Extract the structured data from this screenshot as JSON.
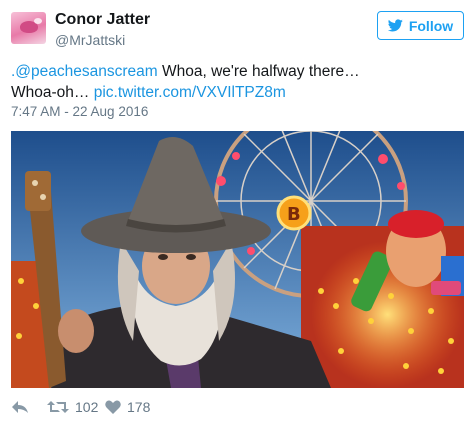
{
  "user": {
    "display_name": "Conor Jatter",
    "handle": "@MrJattski",
    "avatar_icon": "pink-blob-avatar"
  },
  "follow_button": {
    "label": "Follow",
    "icon": "twitter-bird-icon"
  },
  "tweet": {
    "mention": ".@peachesanscream",
    "text_part1": " Whoa, we're halfway there…",
    "text_part2": "Whoa-oh… ",
    "link": "pic.twitter.com/VXVIlTPZ8m",
    "timestamp": "7:47 AM - 22 Aug 2016"
  },
  "photo": {
    "subject": "bearded-wizard-with-hat-at-carnival",
    "sign_letter": "B"
  },
  "actions": {
    "reply_icon": "reply-icon",
    "retweet_icon": "retweet-icon",
    "retweet_count": "102",
    "like_icon": "heart-icon",
    "like_count": "178"
  },
  "colors": {
    "accent": "#1da1f2",
    "link": "#1b95e0",
    "muted": "#657786"
  }
}
